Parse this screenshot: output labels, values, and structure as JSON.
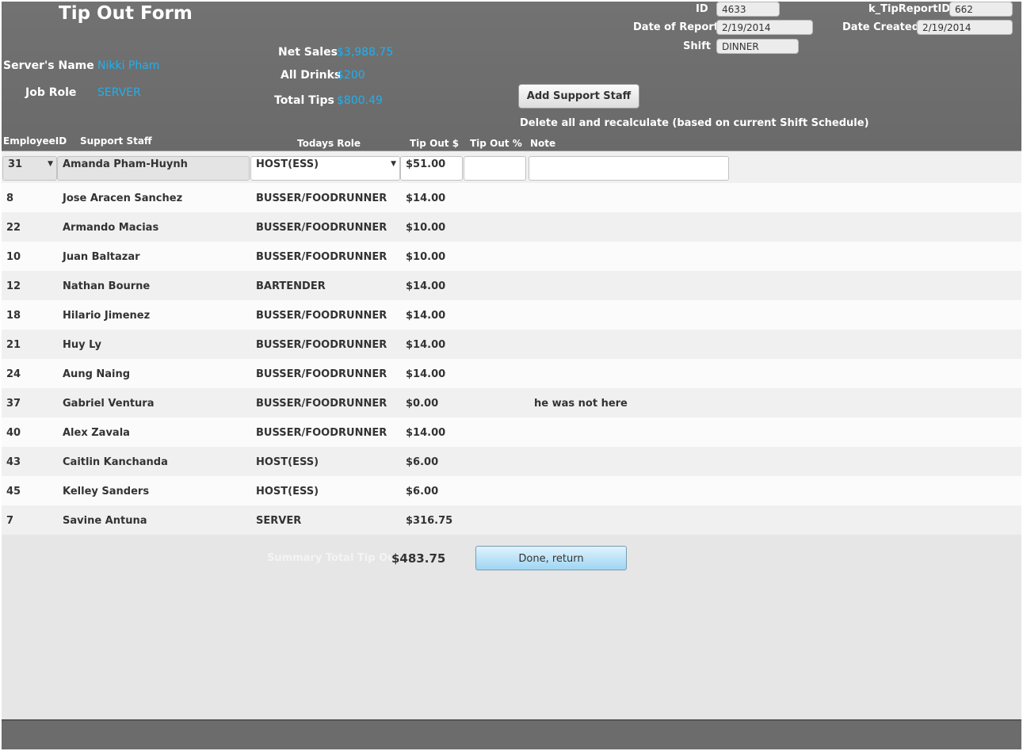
{
  "header": {
    "title": "Tip Out Form",
    "server_name_label": "Server's Name",
    "server_name": "Nikki Pham",
    "job_role_label": "Job Role",
    "job_role": "SERVER",
    "net_sales_label": "Net Sales",
    "net_sales": "$3,988.75",
    "all_drinks_label": "All Drinks",
    "all_drinks": "$200",
    "total_tips_label": "Total Tips",
    "total_tips": "$800.49",
    "id_label": "ID",
    "id_value": "4633",
    "tip_report_label": "k_TipReportID",
    "tip_report_value": "662",
    "date_report_label": "Date of Report",
    "date_report_value": "2/19/2014",
    "date_created_label": "Date Created",
    "date_created_value": "2/19/2014",
    "shift_label": "Shift",
    "shift_value": "DINNER",
    "add_button": "Add Support Staff",
    "delete_text": "Delete all and recalculate (based on current Shift Schedule)"
  },
  "columns": {
    "employee_id": "EmployeeID",
    "support_staff": "Support Staff",
    "todays_role": "Todays Role",
    "tip_out_dollar": "Tip Out $",
    "tip_out_pct": "Tip Out %",
    "note": "Note"
  },
  "first_row": {
    "id": "31",
    "name": "Amanda Pham-Huynh",
    "role": "HOST(ESS)",
    "tip": "$51.00",
    "pct": "",
    "note": ""
  },
  "rows": [
    {
      "id": "8",
      "name": "Jose Aracen Sanchez",
      "role": "BUSSER/FOODRUNNER",
      "tip": "$14.00",
      "note": ""
    },
    {
      "id": "22",
      "name": "Armando Macias",
      "role": "BUSSER/FOODRUNNER",
      "tip": "$10.00",
      "note": ""
    },
    {
      "id": "10",
      "name": "Juan Baltazar",
      "role": "BUSSER/FOODRUNNER",
      "tip": "$10.00",
      "note": ""
    },
    {
      "id": "12",
      "name": "Nathan Bourne",
      "role": "BARTENDER",
      "tip": "$14.00",
      "note": ""
    },
    {
      "id": "18",
      "name": "Hilario Jimenez",
      "role": "BUSSER/FOODRUNNER",
      "tip": "$14.00",
      "note": ""
    },
    {
      "id": "21",
      "name": "Huy Ly",
      "role": "BUSSER/FOODRUNNER",
      "tip": "$14.00",
      "note": ""
    },
    {
      "id": "24",
      "name": "Aung Naing",
      "role": "BUSSER/FOODRUNNER",
      "tip": "$14.00",
      "note": ""
    },
    {
      "id": "37",
      "name": "Gabriel Ventura",
      "role": "BUSSER/FOODRUNNER",
      "tip": "$0.00",
      "note": "he was not here"
    },
    {
      "id": "40",
      "name": "Alex Zavala",
      "role": "BUSSER/FOODRUNNER",
      "tip": "$14.00",
      "note": ""
    },
    {
      "id": "43",
      "name": "Caitlin Kanchanda",
      "role": "HOST(ESS)",
      "tip": "$6.00",
      "note": ""
    },
    {
      "id": "45",
      "name": "Kelley Sanders",
      "role": "HOST(ESS)",
      "tip": "$6.00",
      "note": ""
    },
    {
      "id": "7",
      "name": "Savine Antuna",
      "role": "SERVER",
      "tip": "$316.75",
      "note": ""
    }
  ],
  "summary": {
    "label": "Summary Total Tip Out",
    "value": "$483.75",
    "done_button": "Done, return"
  }
}
